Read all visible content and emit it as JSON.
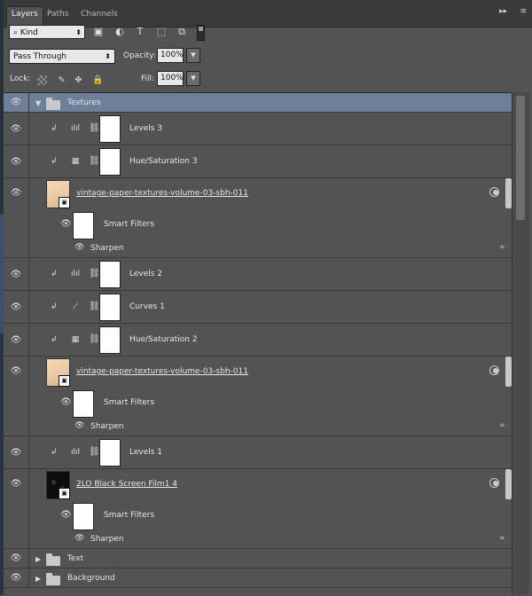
{
  "tabs": {
    "layers": "Layers",
    "paths": "Paths",
    "channels": "Channels",
    "collapse_glyph": "▸▸",
    "menu_glyph": "≡"
  },
  "filter": {
    "kind_label": "Kind",
    "search_glyph": "⌕",
    "icons": {
      "pixel": "▣",
      "adjustment": "◐",
      "type": "T",
      "shape": "⬚",
      "smart_object": "⧉"
    }
  },
  "blend": {
    "mode": "Pass Through",
    "opacity_label": "Opacity:",
    "opacity_value": "100%",
    "drop_glyph": "▼"
  },
  "lock": {
    "label": "Lock:",
    "icons": {
      "brush": "✎",
      "move": "✥",
      "all": "🔒"
    },
    "fill_label": "Fill:",
    "fill_value": "100%"
  },
  "glyphs": {
    "eye": "👁",
    "small_eye": "◉",
    "clip": "↲",
    "link": "⛓",
    "expanded": "▼",
    "collapsed": "▶",
    "levels": "ılıl",
    "hue": "▦",
    "curves": "⟋",
    "filter_options": "⩧"
  },
  "layers": [
    {
      "name": "Textures",
      "type": "group",
      "expanded": true,
      "selected": true
    },
    {
      "name": "Levels 3",
      "type": "levels"
    },
    {
      "name": "Hue/Saturation 3",
      "type": "hue"
    },
    {
      "name": "vintage-paper-textures-volume-03-sbh-011",
      "type": "paper",
      "smart_filters": "Smart Filters",
      "filter": "Sharpen"
    },
    {
      "name": "Levels 2",
      "type": "levels"
    },
    {
      "name": "Curves 1",
      "type": "curves"
    },
    {
      "name": "Hue/Saturation 2",
      "type": "hue"
    },
    {
      "name": "vintage-paper-textures-volume-03-sbh-011",
      "type": "paper",
      "smart_filters": "Smart Filters",
      "filter": "Sharpen"
    },
    {
      "name": "Levels 1",
      "type": "levels"
    },
    {
      "name": "2LO Black Screen Film1 4",
      "type": "black",
      "smart_filters": "Smart Filters",
      "filter": "Sharpen"
    },
    {
      "name": "Text",
      "type": "group",
      "expanded": false
    },
    {
      "name": "Background",
      "type": "group",
      "expanded": false
    }
  ],
  "colors": {
    "panel": "#535353",
    "selected": "#6d7f99",
    "tabbar": "#3a3a3a"
  }
}
